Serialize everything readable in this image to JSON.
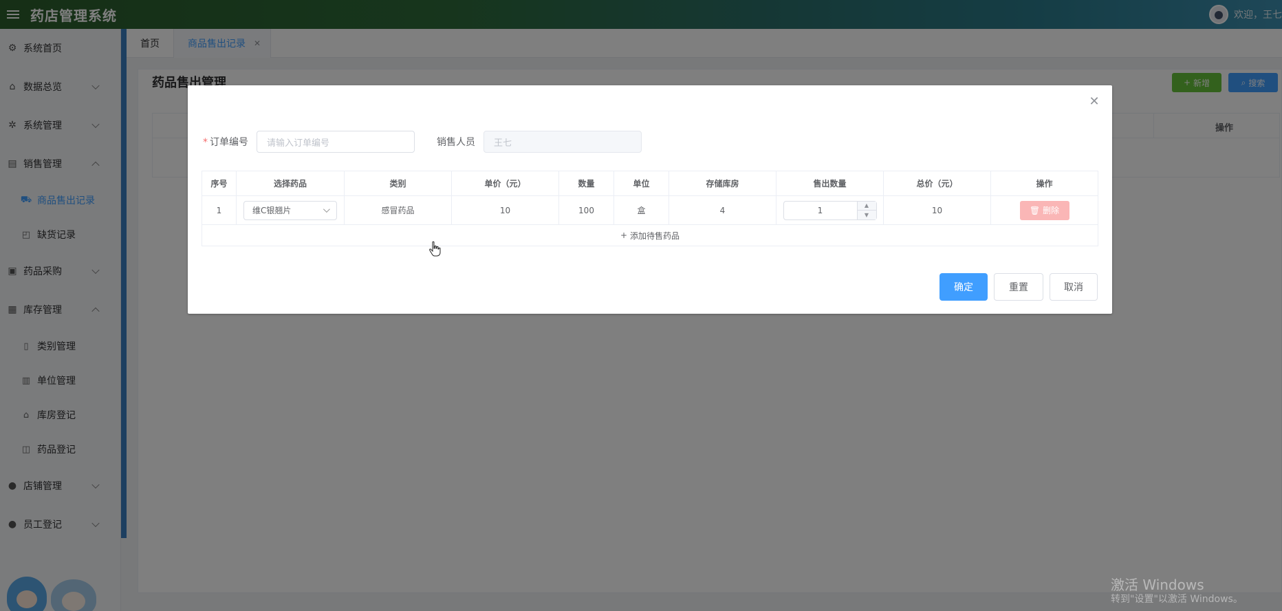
{
  "header": {
    "title": "药店管理系统",
    "welcome": "欢迎，王七"
  },
  "sidebar": {
    "items": [
      {
        "label": "系统首页",
        "icon": "gear-outline-icon"
      },
      {
        "label": "数据总览",
        "icon": "home-icon"
      },
      {
        "label": "系统管理",
        "icon": "gear-icon"
      },
      {
        "label": "销售管理",
        "icon": "chart-icon"
      },
      {
        "label": "商品售出记录",
        "icon": "truck-icon"
      },
      {
        "label": "缺货记录",
        "icon": "bag-icon"
      },
      {
        "label": "药品采购",
        "icon": "lock-icon"
      },
      {
        "label": "库存管理",
        "icon": "briefcase-icon"
      },
      {
        "label": "类别管理",
        "icon": "document-icon"
      },
      {
        "label": "单位管理",
        "icon": "building-icon"
      },
      {
        "label": "库房登记",
        "icon": "house-icon"
      },
      {
        "label": "药品登记",
        "icon": "box-icon"
      },
      {
        "label": "店铺管理",
        "icon": "user-icon"
      },
      {
        "label": "员工登记",
        "icon": "user-icon"
      }
    ]
  },
  "tabs": [
    {
      "label": "首页"
    },
    {
      "label": "商品售出记录"
    }
  ],
  "page": {
    "title": "药品售出管理",
    "add_label": "新增",
    "search_label": "搜索",
    "table_op_header": "操作"
  },
  "dialog": {
    "order_label": "订单编号",
    "order_placeholder": "请输入订单编号",
    "seller_label": "销售人员",
    "seller_value": "王七",
    "columns": [
      "序号",
      "选择药品",
      "类别",
      "单价（元）",
      "数量",
      "单位",
      "存储库房",
      "售出数量",
      "总价（元）",
      "操作"
    ],
    "row": {
      "index": "1",
      "drug": "维C银翘片",
      "category": "感冒药品",
      "price": "10",
      "quantity": "100",
      "unit": "盒",
      "warehouse": "4",
      "sell_qty": "1",
      "total": "10",
      "delete_label": "删除"
    },
    "add_row_label": "添加待售药品",
    "confirm_label": "确定",
    "reset_label": "重置",
    "cancel_label": "取消"
  },
  "watermark": {
    "line1": "激活 Windows",
    "line2": "转到\"设置\"以激活 Windows。"
  }
}
